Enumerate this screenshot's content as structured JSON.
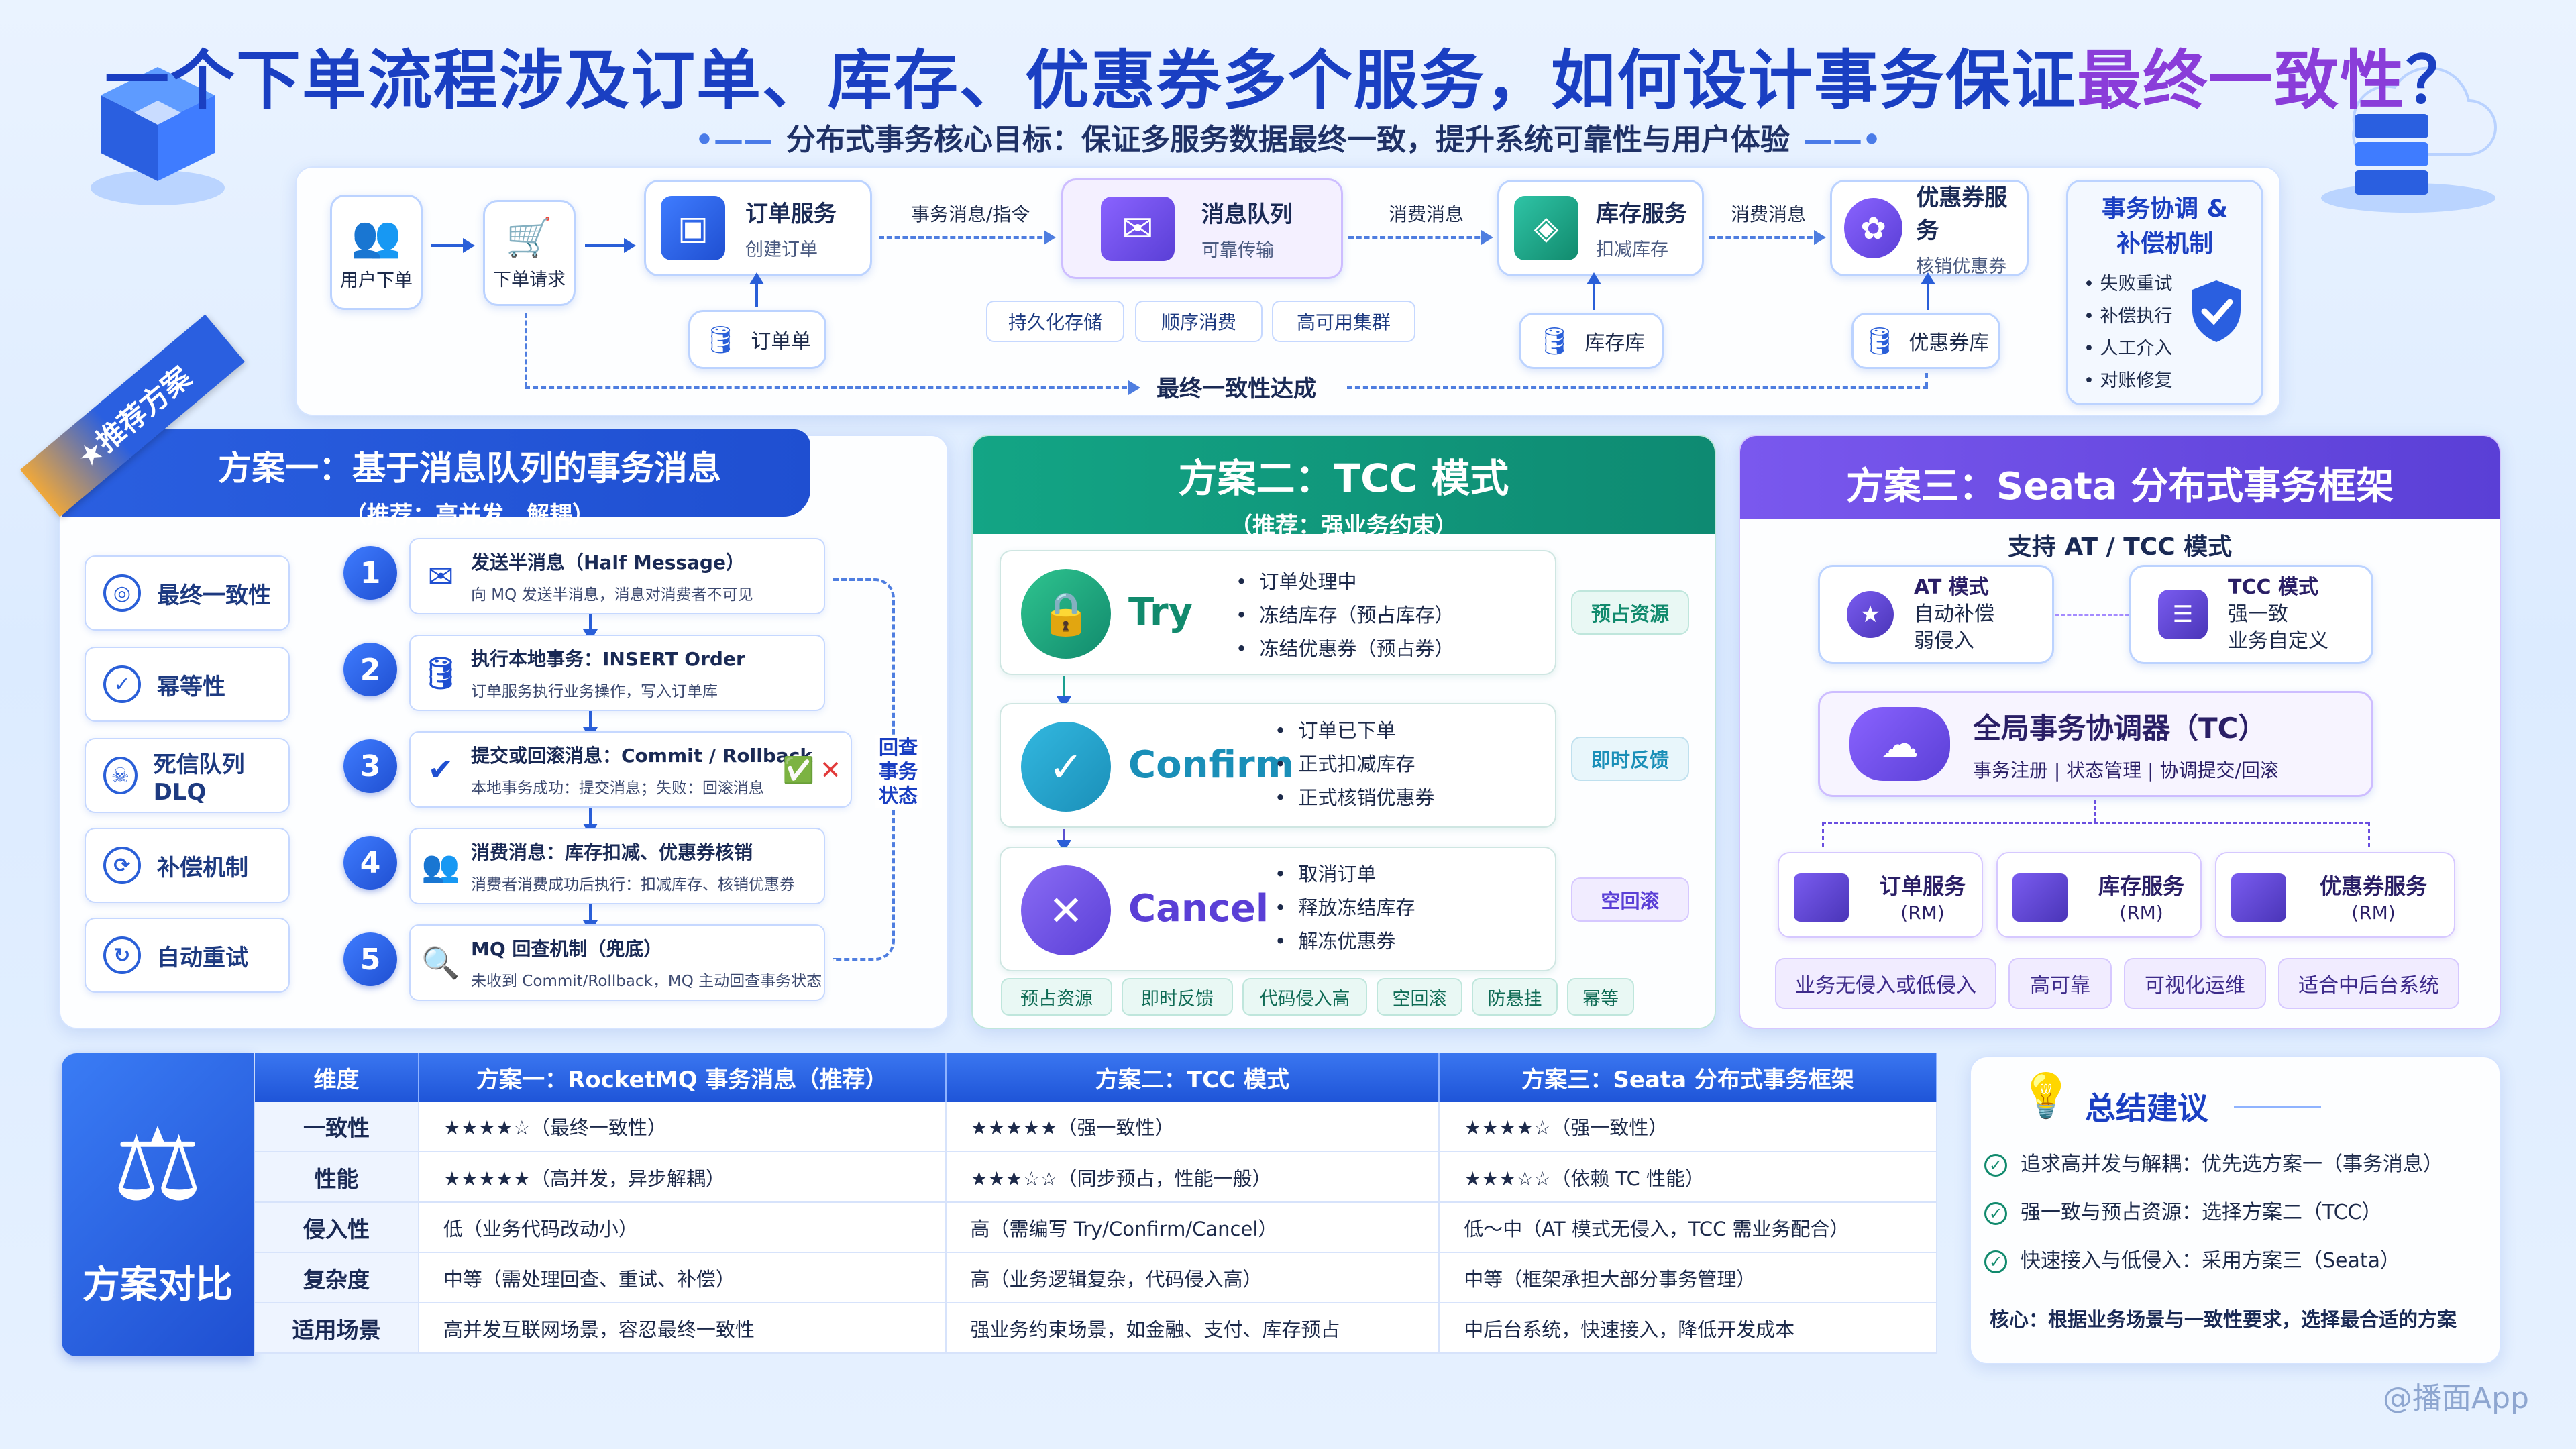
{
  "header": {
    "title_main": "一个下单流程涉及订单、库存、优惠券多个服务，如何设计事务保证",
    "title_highlight": "最终一致性",
    "title_end": "？",
    "subtitle": "分布式事务核心目标：保证多服务数据最终一致，提升系统可靠性与用户体验"
  },
  "flow": {
    "user_order": "用户下单",
    "order_request": "下单请求",
    "order_service": {
      "title": "订单服务",
      "sub": "创建订单"
    },
    "mq": {
      "title": "消息队列",
      "sub": "可靠传输"
    },
    "stock_service": {
      "title": "库存服务",
      "sub": "扣减库存"
    },
    "coupon_service": {
      "title": "优惠券服务",
      "sub": "核销优惠券"
    },
    "edge_labels": [
      "事务消息/指令",
      "消费消息",
      "消费消息"
    ],
    "db_order": "订单单",
    "db_stock": "库存库",
    "db_coupon": "优惠券库",
    "mq_features": [
      "持久化存储",
      "顺序消费",
      "高可用集群"
    ],
    "final": "最终一致性达成",
    "coord": {
      "title_line1": "事务协调 &",
      "title_line2": "补偿机制",
      "items": [
        "失败重试",
        "补偿执行",
        "人工介入",
        "对账修复"
      ]
    }
  },
  "scheme1": {
    "ribbon": "★推荐方案",
    "title": "方案一：基于消息队列的事务消息",
    "subtitle": "（推荐：高并发、解耦）",
    "features": [
      "最终一致性",
      "幂等性",
      "死信队列 DLQ",
      "补偿机制",
      "自动重试"
    ],
    "steps": [
      {
        "num": "1",
        "title": "发送半消息（Half Message）",
        "desc": "向 MQ 发送半消息，消息对消费者不可见"
      },
      {
        "num": "2",
        "title": "执行本地事务：INSERT Order",
        "desc": "订单服务执行业务操作，写入订单库"
      },
      {
        "num": "3",
        "title": "提交或回滚消息：Commit / Rollback",
        "desc": "本地事务成功：提交消息；失败：回滚消息"
      },
      {
        "num": "4",
        "title": "消费消息：库存扣减、优惠券核销",
        "desc": "消费者消费成功后执行：扣减库存、核销优惠券"
      },
      {
        "num": "5",
        "title": "MQ 回查机制（兜底）",
        "desc": "未收到 Commit/Rollback，MQ 主动回查事务状态"
      }
    ],
    "check_back": [
      "回查",
      "事务",
      "状态"
    ]
  },
  "scheme2": {
    "title": "方案二：TCC 模式",
    "subtitle": "（推荐：强业务约束）",
    "phases": [
      {
        "name": "Try",
        "items": [
          "订单处理中",
          "冻结库存（预占库存）",
          "冻结优惠券（预占券）"
        ],
        "tag": "预占资源",
        "color": "#1aa37f"
      },
      {
        "name": "Confirm",
        "items": [
          "订单已下单",
          "正式扣减库存",
          "正式核销优惠券"
        ],
        "tag": "即时反馈",
        "color": "#1a9fbf"
      },
      {
        "name": "Cancel",
        "items": [
          "取消订单",
          "释放冻结库存",
          "解冻优惠券"
        ],
        "tag": "空回滚",
        "color": "#6a4fe0"
      }
    ],
    "tags": [
      "预占资源",
      "即时反馈",
      "代码侵入高",
      "空回滚",
      "防悬挂",
      "幂等"
    ]
  },
  "scheme3": {
    "title": "方案三：Seata 分布式事务框架",
    "support": "支持 AT / TCC 模式",
    "at": {
      "title": "AT 模式",
      "lines": [
        "自动补偿",
        "弱侵入"
      ]
    },
    "tcc": {
      "title": "TCC 模式",
      "lines": [
        "强一致",
        "业务自定义"
      ]
    },
    "tc": {
      "title": "全局事务协调器（TC）",
      "sub": "事务注册 | 状态管理 | 协调提交/回滚"
    },
    "rms": [
      {
        "title": "订单服务",
        "sub": "(RM)"
      },
      {
        "title": "库存服务",
        "sub": "(RM)"
      },
      {
        "title": "优惠券服务",
        "sub": "(RM)"
      }
    ],
    "tags": [
      "业务无侵入或低侵入",
      "高可靠",
      "可视化运维",
      "适合中后台系统"
    ]
  },
  "compare": {
    "label": "方案对比",
    "headers": [
      "维度",
      "方案一：RocketMQ 事务消息（推荐）",
      "方案二：TCC 模式",
      "方案三：Seata 分布式事务框架"
    ],
    "rows": [
      [
        "一致性",
        "★★★★☆（最终一致性）",
        "★★★★★（强一致性）",
        "★★★★☆（强一致性）"
      ],
      [
        "性能",
        "★★★★★（高并发，异步解耦）",
        "★★★☆☆（同步预占，性能一般）",
        "★★★☆☆（依赖 TC 性能）"
      ],
      [
        "侵入性",
        "低（业务代码改动小）",
        "高（需编写 Try/Confirm/Cancel）",
        "低～中（AT 模式无侵入，TCC 需业务配合）"
      ],
      [
        "复杂度",
        "中等（需处理回查、重试、补偿）",
        "高（业务逻辑复杂，代码侵入高）",
        "中等（框架承担大部分事务管理）"
      ],
      [
        "适用场景",
        "高并发互联网场景，容忍最终一致性",
        "强业务约束场景，如金融、支付、库存预占",
        "中后台系统，快速接入，降低开发成本"
      ]
    ]
  },
  "summary": {
    "title": "总结建议",
    "items": [
      "追求高并发与解耦：优先选方案一（事务消息）",
      "强一致与预占资源：选择方案二（TCC）",
      "快速接入与低侵入：采用方案三（Seata）"
    ],
    "core": "核心：根据业务场景与一致性要求，选择最合适的方案"
  },
  "watermark": "@播面App",
  "colors": {
    "primary": "#1f55d8",
    "teal": "#12a07f",
    "purple": "#6a4fe0"
  }
}
